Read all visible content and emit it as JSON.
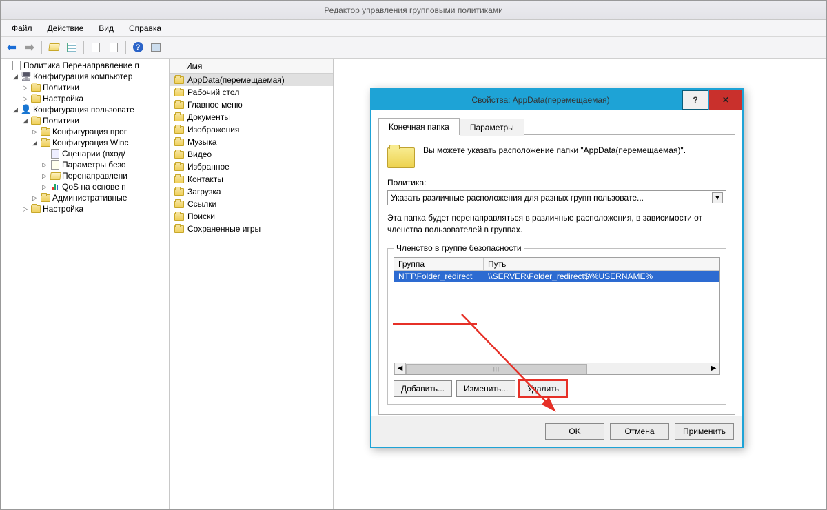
{
  "window": {
    "title": "Редактор управления групповыми политиками"
  },
  "menu": {
    "file": "Файл",
    "action": "Действие",
    "view": "Вид",
    "help": "Справка"
  },
  "toolbar_icons": [
    "back",
    "forward",
    "up",
    "properties",
    "export",
    "refresh",
    "help",
    "filter"
  ],
  "tree": {
    "root": "Политика Перенаправление п",
    "comp_cfg": "Конфигурация компьютер",
    "comp_policies": "Политики",
    "comp_settings": "Настройка",
    "user_cfg": "Конфигурация пользовате",
    "user_policies": "Политики",
    "soft_cfg": "Конфигурация прог",
    "win_cfg": "Конфигурация Winc",
    "scenarios": "Сценарии (вход/",
    "sec_params": "Параметры безо",
    "redirect": "Перенаправлени",
    "qos": "QoS на основе п",
    "admin": "Административные",
    "user_settings": "Настройка"
  },
  "list_header": "Имя",
  "items": [
    {
      "label": "AppData(перемещаемая)",
      "selected": true
    },
    {
      "label": "Рабочий стол"
    },
    {
      "label": "Главное меню"
    },
    {
      "label": "Документы"
    },
    {
      "label": "Изображения"
    },
    {
      "label": "Музыка"
    },
    {
      "label": "Видео"
    },
    {
      "label": "Избранное"
    },
    {
      "label": "Контакты"
    },
    {
      "label": "Загрузка"
    },
    {
      "label": "Ссылки"
    },
    {
      "label": "Поиски"
    },
    {
      "label": "Сохраненные игры"
    }
  ],
  "dialog": {
    "title": "Свойства: AppData(перемещаемая)",
    "tabs": {
      "target": "Конечная папка",
      "settings": "Параметры"
    },
    "info": "Вы можете указать расположение папки \"AppData(перемещаемая)\".",
    "policy_label": "Политика:",
    "policy_value": "Указать различные расположения для разных групп пользовате...",
    "hint": "Эта папка будет перенаправляться в различные расположения, в зависимости от членства пользователей в группах.",
    "group_legend": "Членство в группе безопасности",
    "th_group": "Группа",
    "th_path": "Путь",
    "row_group": "NTT\\Folder_redirect",
    "row_path": "\\\\SERVER\\Folder_redirect$\\%USERNAME%",
    "btn_add": "Добавить...",
    "btn_edit": "Изменить...",
    "btn_del": "Удалить",
    "ok": "OK",
    "cancel": "Отмена",
    "apply": "Применить"
  }
}
